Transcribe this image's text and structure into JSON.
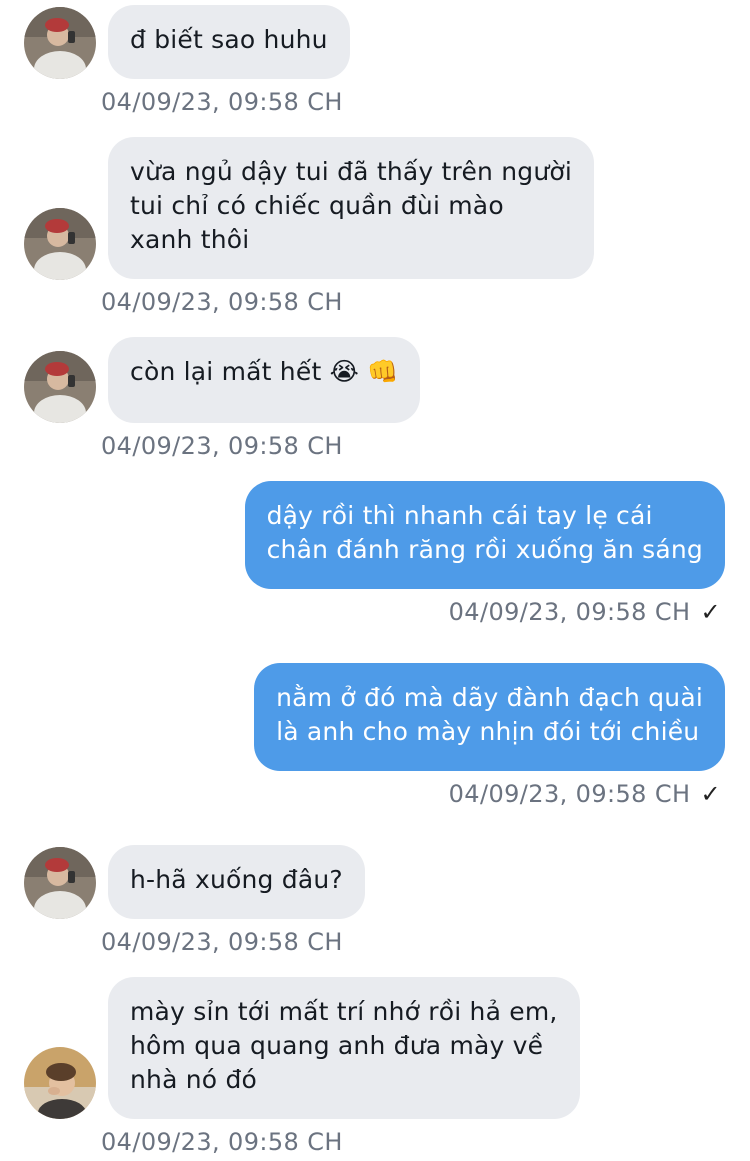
{
  "messages": [
    {
      "direction": "in",
      "text": "đ biết sao huhu",
      "timestamp": "04/09/23, 09:58 CH",
      "avatar": "avatar-selfie"
    },
    {
      "direction": "in",
      "text": "vừa ngủ dậy tui đã thấy trên người\ntui chỉ có chiếc quần đùi mào\nxanh thôi",
      "timestamp": "04/09/23, 09:58 CH",
      "avatar": "avatar-selfie"
    },
    {
      "direction": "in",
      "text": "còn lại mất hết 😭 👊",
      "timestamp": "04/09/23, 09:58 CH",
      "avatar": "avatar-selfie"
    },
    {
      "direction": "out",
      "text": "dậy rồi thì nhanh cái tay lẹ cái\nchân đánh răng rồi xuống ăn sáng",
      "timestamp": "04/09/23, 09:58 CH",
      "status": "✓"
    },
    {
      "direction": "out",
      "text": "nằm ở đó mà dãy đành đạch quài\nlà anh cho mày nhịn đói tới chiều",
      "timestamp": "04/09/23, 09:58 CH",
      "status": "✓"
    },
    {
      "direction": "in",
      "text": "h-hã xuống đâu?",
      "timestamp": "04/09/23, 09:58 CH",
      "avatar": "avatar-selfie"
    },
    {
      "direction": "in",
      "text": "mày sỉn tới mất trí nhớ rồi hả em,\nhôm qua quang anh đưa mày về\nnhà nó đó",
      "timestamp": "04/09/23, 09:58 CH",
      "avatar": "avatar-portrait"
    }
  ],
  "colors": {
    "incoming_bubble": "#e9ebef",
    "outgoing_bubble": "#4e9be8",
    "timestamp": "#6b7380"
  }
}
